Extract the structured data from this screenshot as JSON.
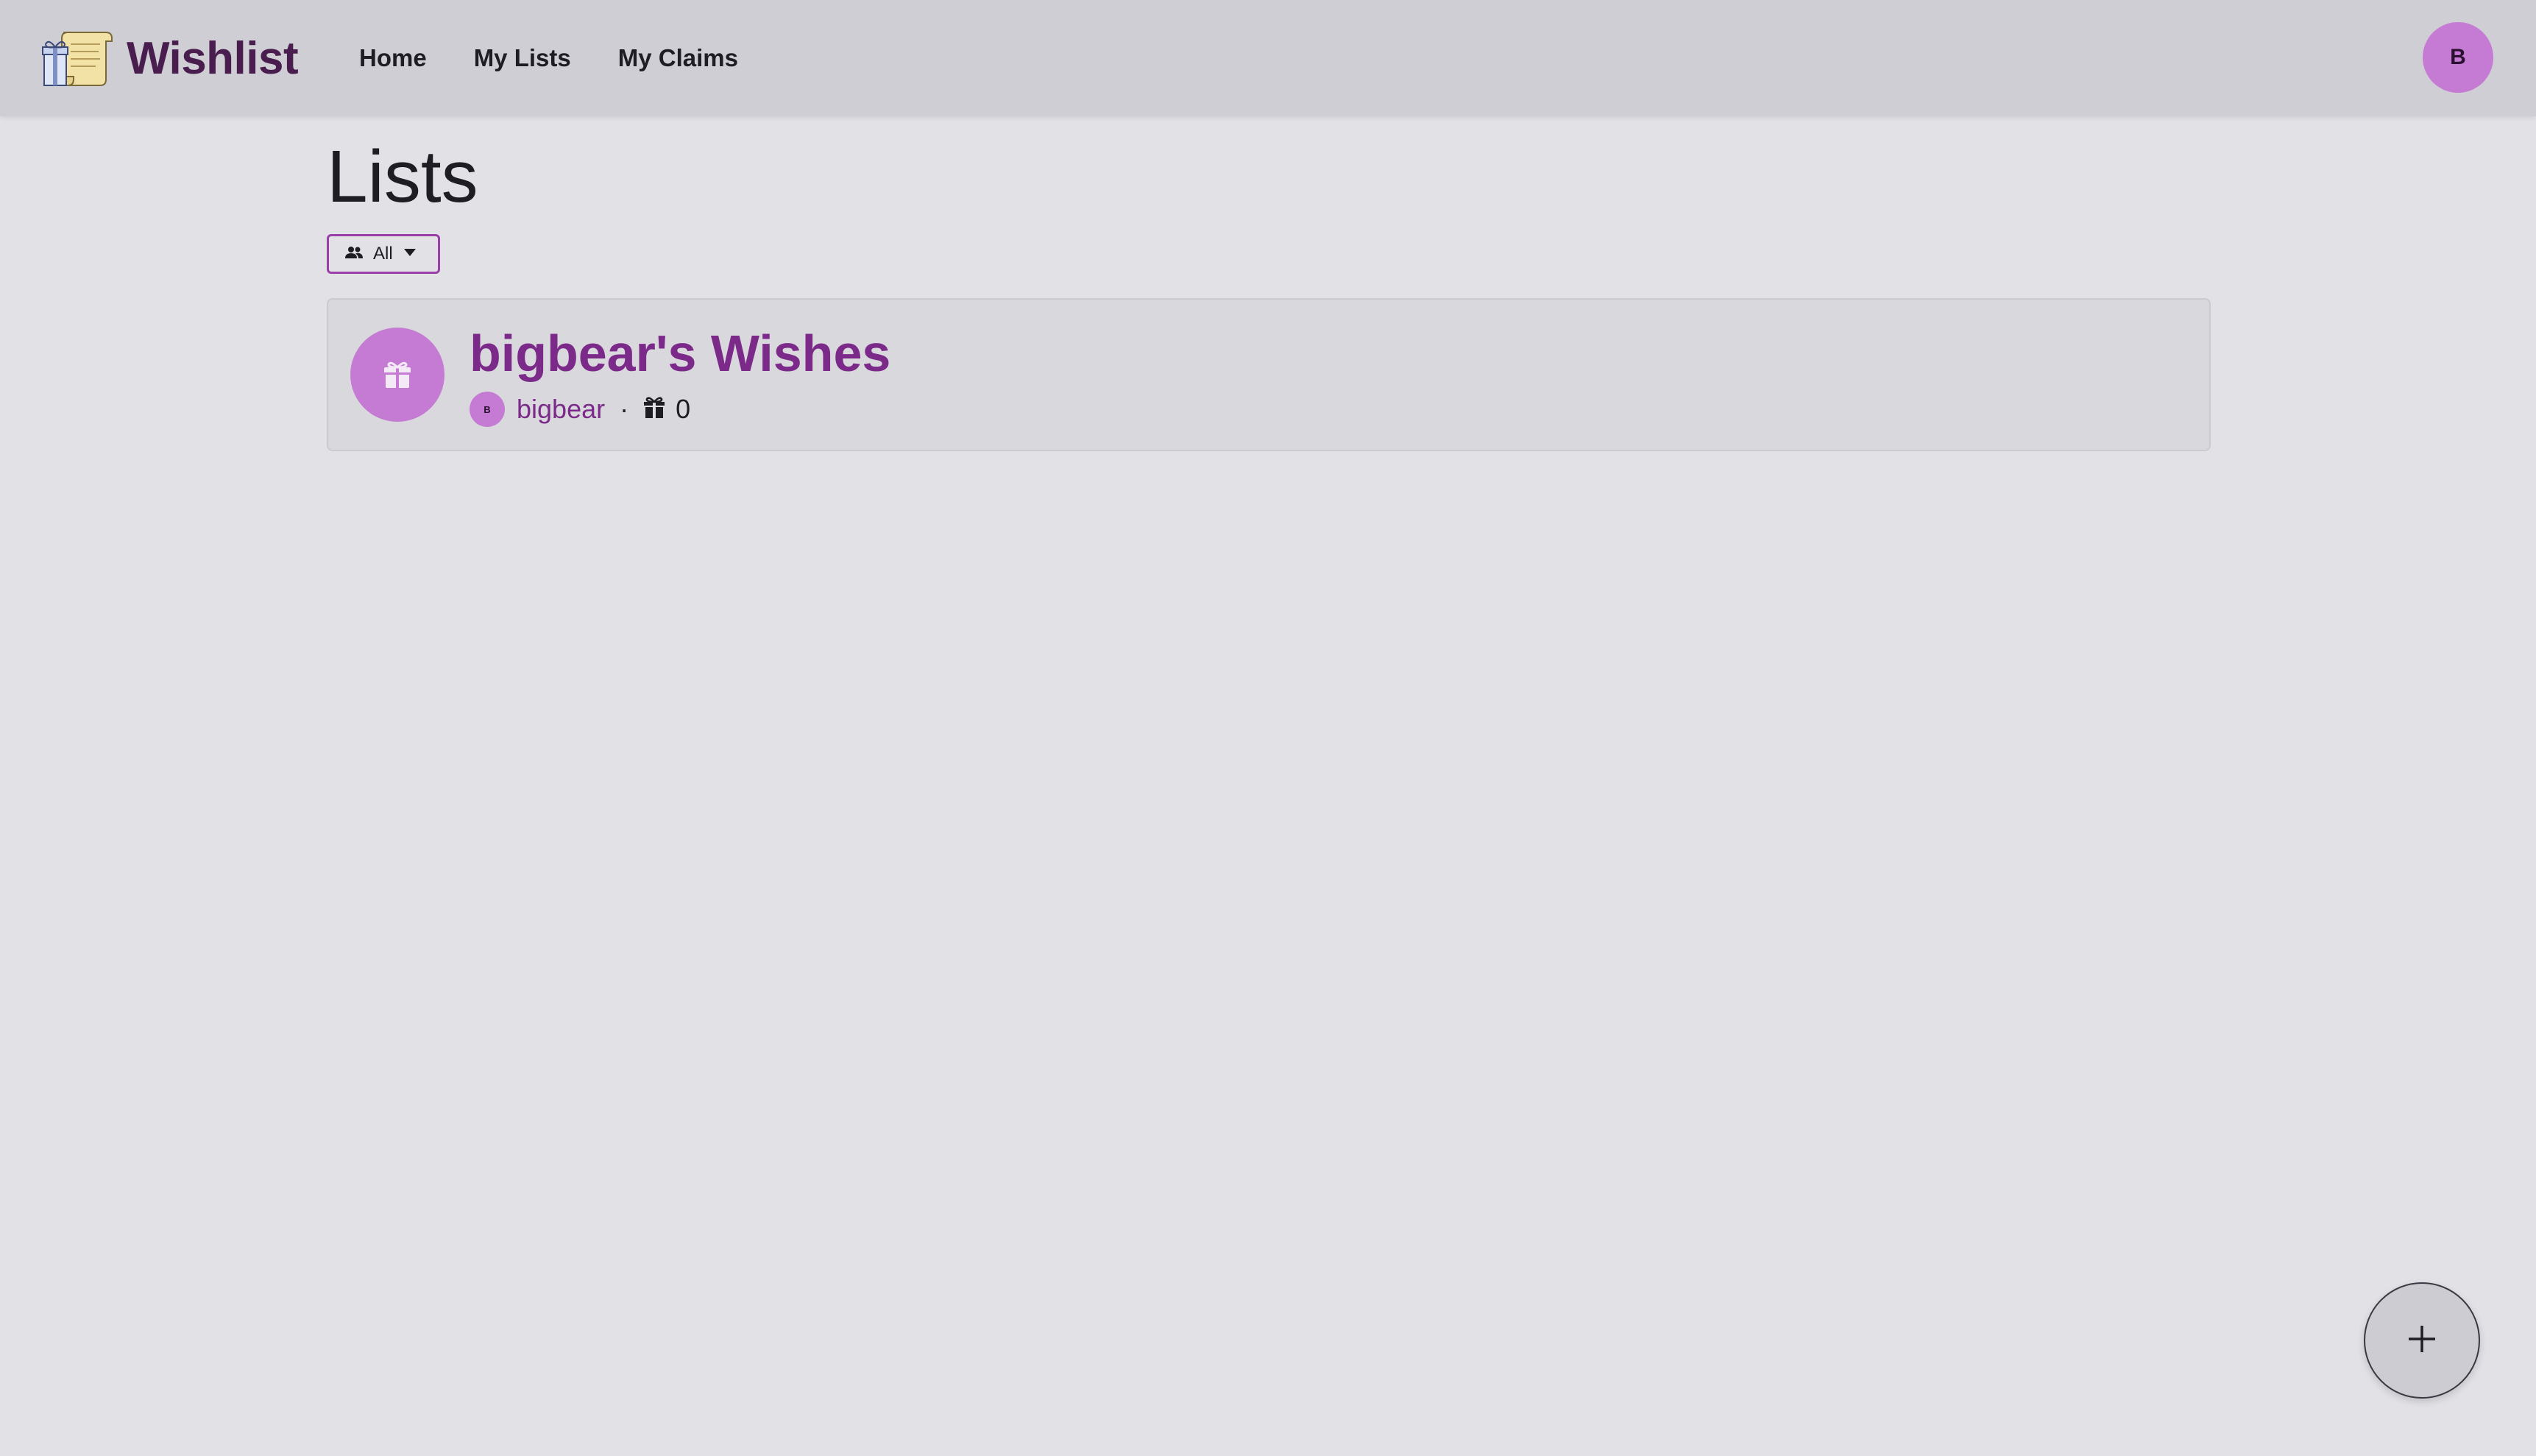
{
  "header": {
    "brand_name": "Wishlist",
    "nav": [
      {
        "label": "Home"
      },
      {
        "label": "My Lists"
      },
      {
        "label": "My Claims"
      }
    ],
    "user_avatar_initial": "B"
  },
  "main": {
    "title": "Lists",
    "filter": {
      "icon": "users-icon",
      "selected": "All"
    },
    "lists": [
      {
        "name": "bigbear's Wishes",
        "icon": "gift-icon",
        "owner": "bigbear",
        "owner_initial": "B",
        "separator": "·",
        "item_count": "0"
      }
    ]
  },
  "fab": {
    "icon": "plus-icon"
  },
  "colors": {
    "accent": "#c57ad4",
    "title_purple": "#7b2a8a",
    "brand_purple": "#4a1d4f",
    "background": "#e2e1e6",
    "header_bg": "#cfced4"
  }
}
